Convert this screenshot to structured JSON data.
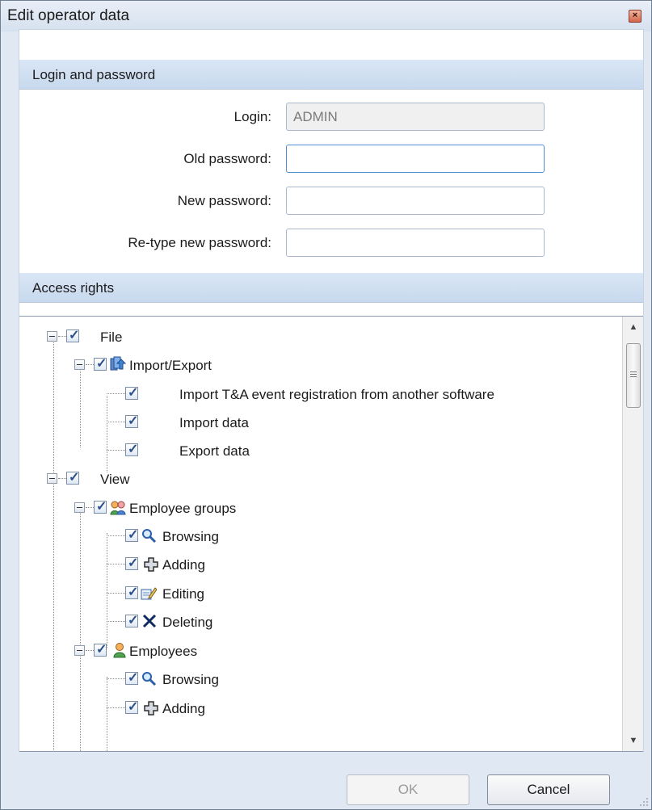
{
  "window": {
    "title": "Edit operator data",
    "close_icon": "close-icon"
  },
  "login_section": {
    "title": "Login and password",
    "fields": {
      "login": {
        "label": "Login:",
        "value": "ADMIN"
      },
      "old_password": {
        "label": "Old password:",
        "value": ""
      },
      "new_password": {
        "label": "New password:",
        "value": ""
      },
      "retype_password": {
        "label": "Re-type new password:",
        "value": ""
      }
    }
  },
  "access_section": {
    "title": "Access rights",
    "tree": [
      {
        "label": "File",
        "checked": true
      },
      {
        "label": "Import/Export",
        "checked": true,
        "icon": "import-export-icon"
      },
      {
        "label": "Import T&A event registration from another software",
        "checked": true
      },
      {
        "label": "Import data",
        "checked": true
      },
      {
        "label": "Export data",
        "checked": true
      },
      {
        "label": "View",
        "checked": true
      },
      {
        "label": "Employee groups",
        "checked": true,
        "icon": "employee-groups-icon"
      },
      {
        "label": "Browsing",
        "checked": true,
        "icon": "magnifier-icon"
      },
      {
        "label": "Adding",
        "checked": true,
        "icon": "plus-icon"
      },
      {
        "label": "Editing",
        "checked": true,
        "icon": "edit-icon"
      },
      {
        "label": "Deleting",
        "checked": true,
        "icon": "delete-icon"
      },
      {
        "label": "Employees",
        "checked": true,
        "icon": "employee-icon"
      },
      {
        "label": "Browsing",
        "checked": true,
        "icon": "magnifier-icon"
      },
      {
        "label": "Adding",
        "checked": true,
        "icon": "plus-icon"
      }
    ]
  },
  "buttons": {
    "ok": "OK",
    "cancel": "Cancel"
  },
  "colors": {
    "header_blue": "#c8d9ee",
    "window_bg": "#dfe8f3",
    "checkmark": "#2b4f8a"
  }
}
